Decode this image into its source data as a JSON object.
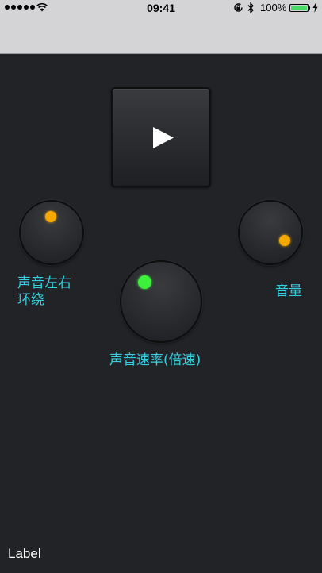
{
  "status_bar": {
    "time": "09:41",
    "battery_percent": "100%",
    "battery_level": 1.0,
    "signal_dots": 5,
    "icons": [
      "signal-dots-icon",
      "wifi-icon",
      "orientation-lock-icon",
      "bluetooth-icon",
      "battery-icon",
      "charging-bolt-icon"
    ]
  },
  "player": {
    "play_icon": "play-icon"
  },
  "controls": {
    "balance_label_line1": "声音左右",
    "balance_label_line2": "环绕",
    "volume_label": "音量",
    "speed_label": "声音速率(倍速)"
  },
  "footer": {
    "label": "Label"
  },
  "colors": {
    "background": "#212327",
    "top_bar": "#d4d4d6",
    "label_text": "#35d0e0",
    "balance_indicator": "#f5a800",
    "volume_indicator": "#f5a800",
    "speed_indicator": "#3cf03c",
    "battery": "#4cd964"
  }
}
